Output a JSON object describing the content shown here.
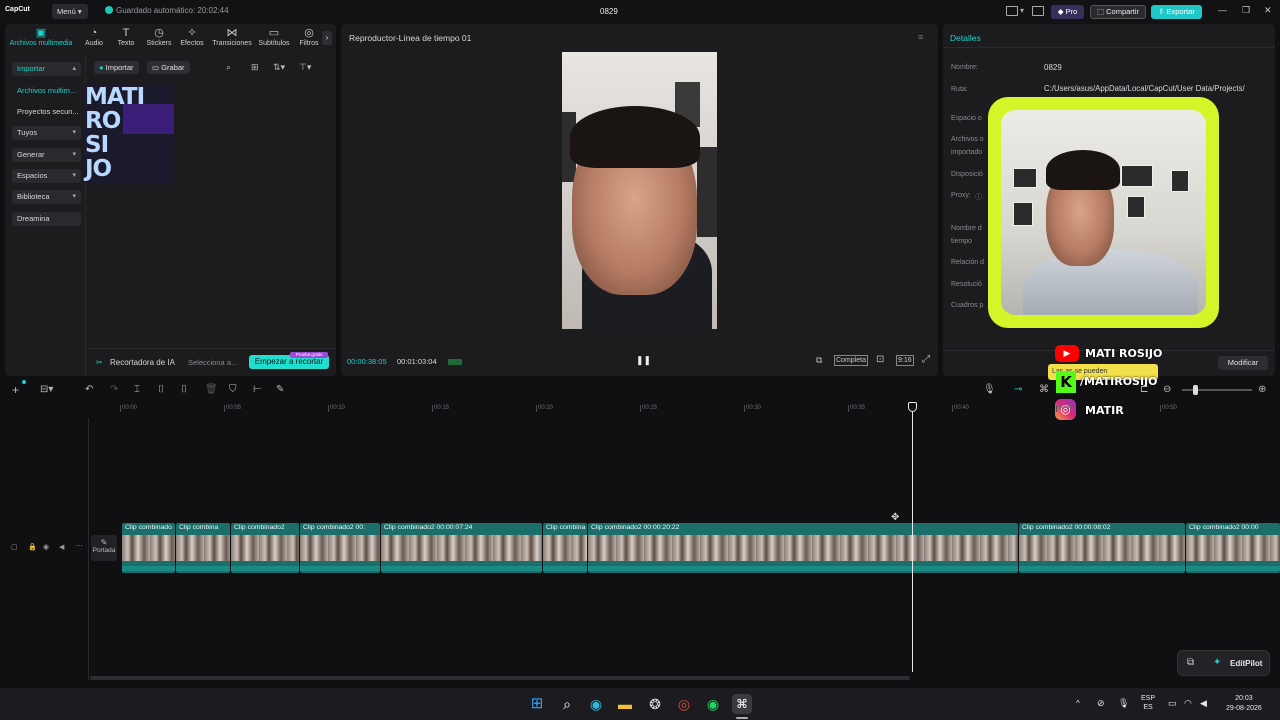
{
  "titlebar": {
    "app_name": "CapCut",
    "menu_label": "Menú",
    "autosave_text": "Guardado automático: 20:02:44",
    "project_name": "0829",
    "pro_label": "Pro",
    "share_label": "Compartir",
    "export_label": "Exportar"
  },
  "media_tabs": [
    {
      "label": "Archivos multimedia",
      "icon": "media-icon",
      "active": true
    },
    {
      "label": "Audio",
      "icon": "audio-icon"
    },
    {
      "label": "Texto",
      "icon": "text-icon"
    },
    {
      "label": "Stickers",
      "icon": "sticker-icon"
    },
    {
      "label": "Efectos",
      "icon": "effects-icon"
    },
    {
      "label": "Transiciones",
      "icon": "transitions-icon"
    },
    {
      "label": "Subtítulos",
      "icon": "subtitles-icon"
    },
    {
      "label": "Filtros",
      "icon": "filters-icon"
    }
  ],
  "sidebar": {
    "items": [
      {
        "label": "Importar",
        "chevron": "▲",
        "boxed": true
      },
      {
        "label": "Archivos multim...",
        "active": true
      },
      {
        "label": "Proyectos secun..."
      },
      {
        "label": "Tuyos",
        "chevron": "▾",
        "boxed": true
      },
      {
        "label": "Generar",
        "chevron": "▾",
        "boxed": true
      },
      {
        "label": "Espacios",
        "chevron": "▾",
        "boxed": true
      },
      {
        "label": "Biblioteca",
        "chevron": "▾",
        "boxed": true
      },
      {
        "label": "Dreamina",
        "boxed": true
      }
    ]
  },
  "media_toolbar": {
    "import_label": "Importar",
    "record_label": "Grabar"
  },
  "media_logo": {
    "line1": "MATI",
    "line2": "RO",
    "line3": "SI",
    "line4": "JO"
  },
  "ai_recorder": {
    "label": "Recortadora de IA",
    "placeholder": "Selecciona a...",
    "button": "Empezar a recortar",
    "badge": "Prueba gratis"
  },
  "player": {
    "title": "Reproductor-Línea de tiempo 01",
    "current_time": "00:00:38:05",
    "total_time": "00:01:03:04",
    "quality": "Completa",
    "ratio": "9:16"
  },
  "details": {
    "title": "Detalles",
    "rows": [
      {
        "label": "Nombre:",
        "value": "0829"
      },
      {
        "label": "Ruta:",
        "value": "C:/Users/asus/AppData/Local/CapCut/User Data/Projects/"
      },
      {
        "label": "Espacio o",
        "value": ""
      },
      {
        "label": "Archivos o",
        "value": ""
      },
      {
        "label": "importado",
        "value": ""
      },
      {
        "label": "Disposició",
        "value": ""
      },
      {
        "label": "Proxy:",
        "value": ""
      },
      {
        "label": "Nombre d",
        "value": ""
      },
      {
        "label": "tiempo",
        "value": ""
      },
      {
        "label": "Relación d",
        "value": ""
      },
      {
        "label": "Resolució",
        "value": ""
      },
      {
        "label": "Cuadros p",
        "value": ""
      }
    ],
    "modify_label": "Modificar"
  },
  "overlay": {
    "youtube": "MATI ROSIJO",
    "kick": "/MATIROSIJO",
    "instagram": "MATIR",
    "tooltip": "Las as se pueden"
  },
  "ruler": [
    "00:00",
    "00:05",
    "00:10",
    "00:15",
    "00:20",
    "00:25",
    "00:30",
    "00:35",
    "00:40",
    "00:45",
    "00:50"
  ],
  "track": {
    "cover_label": "Portada",
    "clips": [
      {
        "label": "Clip combinado"
      },
      {
        "label": "Clip combina"
      },
      {
        "label": "Clip combinado2"
      },
      {
        "label": "Clip combinado2   00:"
      },
      {
        "label": "Clip combinado2   00:00:07:24"
      },
      {
        "label": "Clip combina"
      },
      {
        "label": "Clip combinado2   00:00:20:22"
      },
      {
        "label": "Clip combinado2   00:00:08:02"
      },
      {
        "label": "Clip combinado2   00:00"
      }
    ]
  },
  "editpilot_label": "EditPilot",
  "taskbar": {
    "lang1": "ESP",
    "lang2": "ES",
    "time": "20:03",
    "date": "29-08-2026"
  },
  "colors": {
    "accent": "#1fd0c8",
    "clip": "#1b6e6a",
    "overlay_frame": "#d6f528"
  }
}
